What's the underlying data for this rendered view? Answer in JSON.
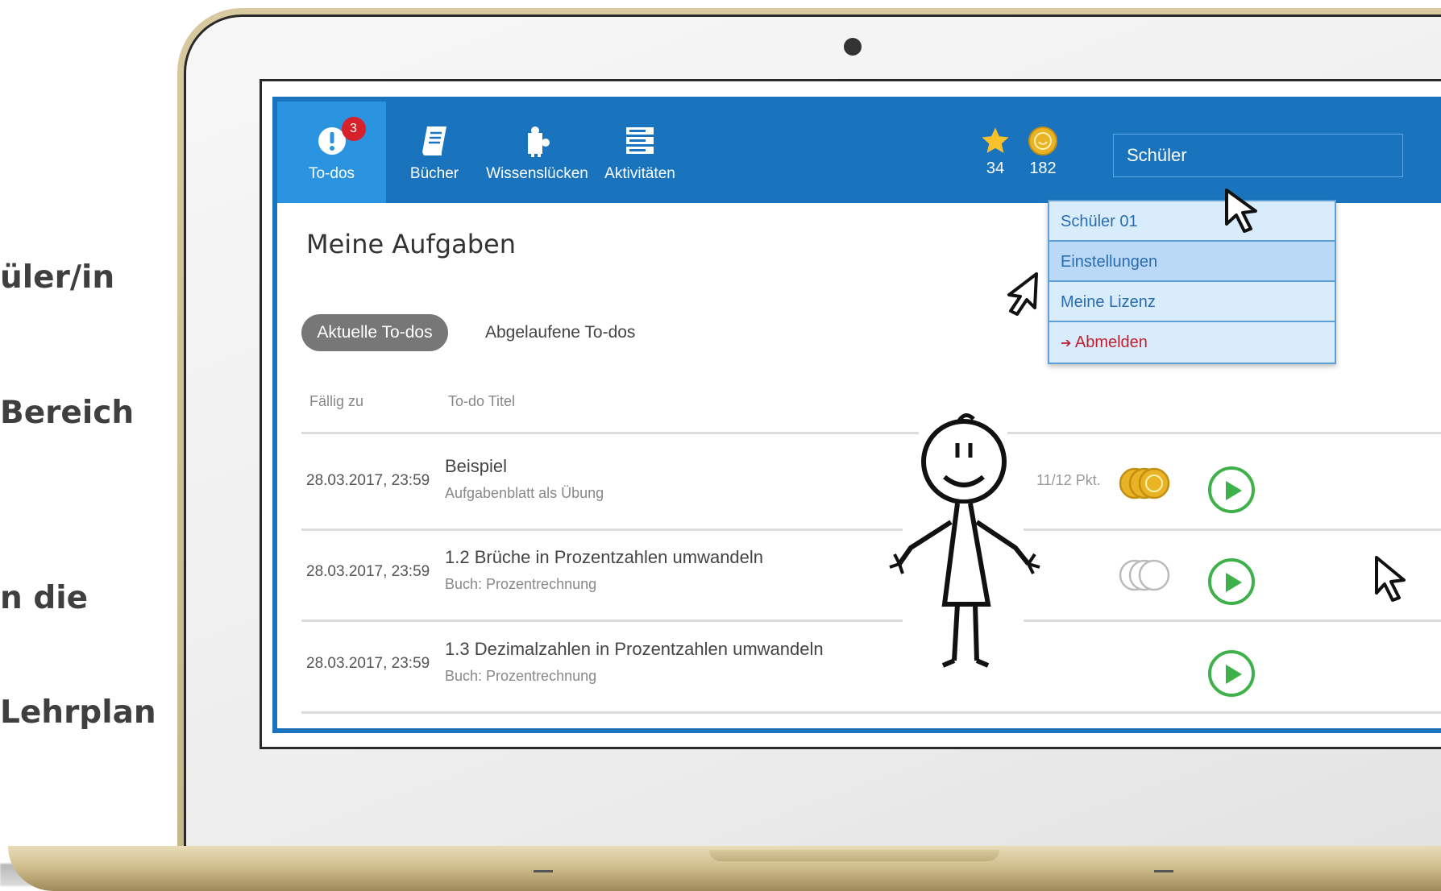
{
  "side_text": [
    "üler/in",
    "Bereich",
    "n die",
    "Lehrplan"
  ],
  "nav": [
    {
      "label": "To-dos",
      "icon": "exclamation-icon",
      "badge": "3",
      "active": true
    },
    {
      "label": "Bücher",
      "icon": "book-icon"
    },
    {
      "label": "Wissenslücken",
      "icon": "puzzle-icon"
    },
    {
      "label": "Aktivitäten",
      "icon": "list-icon"
    }
  ],
  "stats": {
    "stars": "34",
    "coins": "182"
  },
  "user_field": {
    "value": "Schüler"
  },
  "dropdown": [
    {
      "label": "Schüler 01"
    },
    {
      "label": "Einstellungen"
    },
    {
      "label": "Meine Lizenz"
    },
    {
      "label": "Abmelden",
      "icon": "logout-icon"
    }
  ],
  "page_title": "Meine Aufgaben",
  "tabs": {
    "current": "Aktuelle To-dos",
    "expired": "Abgelaufene To-dos"
  },
  "columns": {
    "due": "Fällig zu",
    "title": "To-do Titel"
  },
  "rows": [
    {
      "due": "28.03.2017, 23:59",
      "title": "Beispiel",
      "subtitle": "Aufgabenblatt als Übung",
      "score": "11/12 Pkt.",
      "coins": "gold"
    },
    {
      "due": "28.03.2017, 23:59",
      "title": "1.2 Brüche in Prozentzahlen umwandeln",
      "subtitle": "Buch: Prozentrechnung",
      "score": "",
      "coins": "empty"
    },
    {
      "due": "28.03.2017, 23:59",
      "title": "1.3 Dezimalzahlen in Prozentzahlen umwandeln",
      "subtitle": "Buch: Prozentrechnung",
      "score": "",
      "coins": "none"
    }
  ],
  "colors": {
    "brand_blue": "#1a73bd",
    "active_tab": "#2a94e0",
    "play_green": "#3fb14a",
    "badge_red": "#d6202a",
    "coin_gold": "#e8b324"
  }
}
